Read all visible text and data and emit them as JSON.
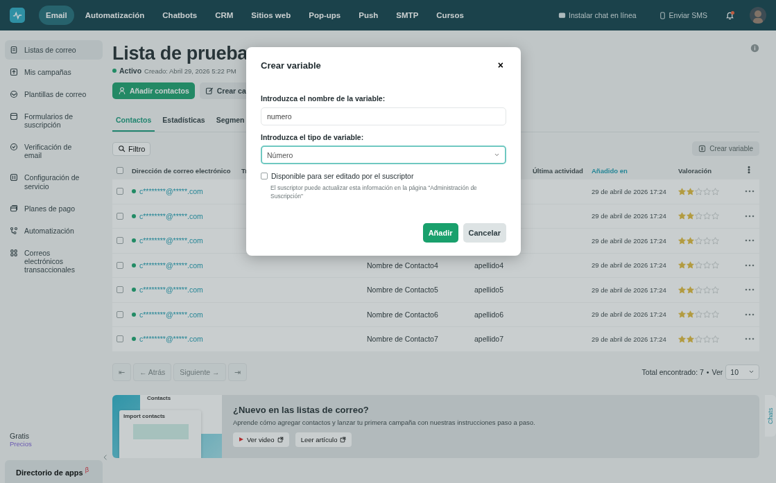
{
  "topbar": {
    "nav": [
      {
        "label": "Email",
        "selected": true
      },
      {
        "label": "Automatización",
        "selected": false
      },
      {
        "label": "Chatbots",
        "selected": false
      },
      {
        "label": "CRM",
        "selected": false
      },
      {
        "label": "Sitios web",
        "selected": false
      },
      {
        "label": "Pop-ups",
        "selected": false
      },
      {
        "label": "Push",
        "selected": false
      },
      {
        "label": "SMTP",
        "selected": false
      },
      {
        "label": "Cursos",
        "selected": false
      }
    ],
    "actions": [
      "Instalar chat en línea",
      "Enviar SMS"
    ]
  },
  "sidebar": {
    "items": [
      {
        "label": "Listas de correo",
        "selected": true
      },
      {
        "label": "Mis campañas",
        "selected": false
      },
      {
        "label": "Plantillas de correo",
        "selected": false
      },
      {
        "label": "Formularios de suscripción",
        "selected": false
      },
      {
        "label": "Verificación de email",
        "selected": false
      },
      {
        "label": "Configuración de servicio",
        "selected": false
      },
      {
        "label": "Planes de pago",
        "selected": false
      },
      {
        "label": "Automatización",
        "selected": false
      },
      {
        "label": "Correos electrónicos transaccionales",
        "selected": false
      }
    ],
    "plan": "Gratis",
    "pricing_link": "Precios",
    "app_directory": "Directorio de apps",
    "app_directory_badge": "β"
  },
  "page": {
    "title": "Lista de prueba",
    "status": "Activo",
    "created": "Creado: Abril 29, 2026 5:22 PM",
    "buttons": [
      {
        "label": "Añadir contactos",
        "kind": "primary"
      },
      {
        "label": "Crear ca",
        "kind": "secondary"
      }
    ],
    "tabs": [
      {
        "label": "Contactos",
        "selected": true
      },
      {
        "label": "Estadísticas",
        "selected": false
      },
      {
        "label": "Segmen",
        "selected": false
      }
    ],
    "filter": "Filtro",
    "create_variable": "Crear variable"
  },
  "table": {
    "select_all_checked": false,
    "columns": [
      {
        "label": "Dirección de correo electrónico",
        "sorted": false
      },
      {
        "label": "Tr",
        "sorted": false
      },
      {
        "label": "Última actividad",
        "sorted": false
      },
      {
        "label": "Añadido en",
        "sorted": true
      },
      {
        "label": "Valoración",
        "sorted": false
      }
    ],
    "rows": [
      {
        "checked": false,
        "email": "c********@*****.com",
        "added": "29 de abril de 2026 17:24",
        "stars": 2
      },
      {
        "checked": false,
        "email": "c********@*****.com",
        "added": "29 de abril de 2026 17:24",
        "stars": 2
      },
      {
        "checked": false,
        "email": "c********@*****.com",
        "added": "29 de abril de 2026 17:24",
        "stars": 2
      },
      {
        "checked": false,
        "email": "c********@*****.com",
        "first_name": "Nombre de Contacto4",
        "last_name": "apellido4",
        "added": "29 de abril de 2026 17:24",
        "stars": 2
      },
      {
        "checked": false,
        "email": "c********@*****.com",
        "first_name": "Nombre de Contacto5",
        "last_name": "apellido5",
        "added": "29 de abril de 2026 17:24",
        "stars": 2
      },
      {
        "checked": false,
        "email": "c********@*****.com",
        "first_name": "Nombre de Contacto6",
        "last_name": "apellido6",
        "added": "29 de abril de 2026 17:24",
        "stars": 2
      },
      {
        "checked": false,
        "email": "c********@*****.com",
        "first_name": "Nombre de Contacto7",
        "last_name": "apellido7",
        "added": "29 de abril de 2026 17:24",
        "stars": 2
      }
    ]
  },
  "pagination": {
    "buttons": [
      "⇤",
      "← Atrás",
      "Siguiente →",
      "⇥"
    ],
    "total": "Total encontrado: 7",
    "separator": "•",
    "per_page_label": "Ver",
    "per_page": "10"
  },
  "banner": {
    "thumbnail_title": "Contacts",
    "thumbnail_subtitle": "Import contacts",
    "title": "¿Nuevo en las listas de correo?",
    "text": "Aprende cómo agregar contactos y lanzar tu primera campaña con nuestras instrucciones paso a paso.",
    "buttons": [
      "Ver video",
      "Leer artículo"
    ]
  },
  "chat_tab": "Chats",
  "dialog": {
    "title": "Crear variable",
    "close": "×",
    "name_label": "Introduzca el nombre de la variable:",
    "name_value": "numero",
    "type_label": "Introduzca el tipo de variable:",
    "type_value": "Número",
    "editable": {
      "label": "Disponible para ser editado por el suscriptor",
      "checked": false
    },
    "hint": "El suscriptor puede actualizar esta información en la página \"Administración de Suscripción\"",
    "buttons": [
      {
        "label": "Añadir",
        "kind": "primary"
      },
      {
        "label": "Cancelar",
        "kind": "secondary"
      }
    ]
  }
}
